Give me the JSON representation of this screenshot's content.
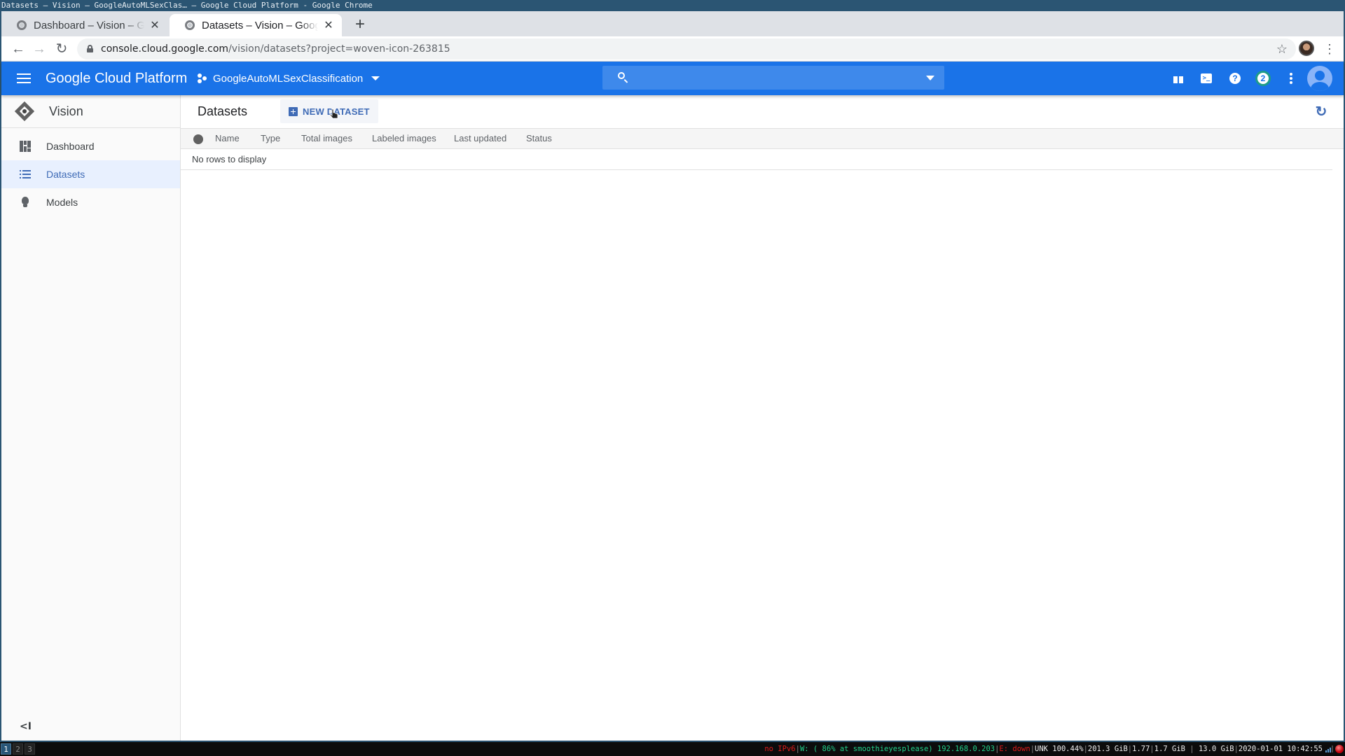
{
  "window": {
    "title": "Datasets – Vision – GoogleAutoMLSexClas… – Google Cloud Platform - Google Chrome"
  },
  "browser": {
    "tabs": [
      {
        "title": "Dashboard – Vision – Google Cloud Platform",
        "active": false
      },
      {
        "title": "Datasets – Vision – Google Cloud Platform",
        "active": true
      }
    ],
    "new_tab_label": "+",
    "url_host": "console.cloud.google.com",
    "url_path": "/vision/datasets?project=woven-icon-263815",
    "icons": {
      "back": "arrow-left-icon",
      "forward": "arrow-right-icon",
      "reload": "reload-icon",
      "lock": "lock-icon",
      "bookmark": "star-icon",
      "profile": "profile-avatar",
      "menu": "kebab-menu-icon"
    }
  },
  "header": {
    "brand": "Google Cloud Platform",
    "project_name": "GoogleAutoMLSexClassification",
    "search_placeholder": "",
    "notification_count": "2",
    "colors": {
      "bar": "#1a73e8",
      "notif_ring": "#1e9c8a"
    }
  },
  "sidebar": {
    "product": "Vision",
    "items": [
      {
        "label": "Dashboard",
        "icon": "dashboard-icon",
        "active": false
      },
      {
        "label": "Datasets",
        "icon": "list-icon",
        "active": true
      },
      {
        "label": "Models",
        "icon": "lightbulb-icon",
        "active": false
      }
    ],
    "collapse_label": "<I",
    "colors": {
      "active_bg": "#e8f0fe",
      "active_text": "#3f6bb6"
    }
  },
  "main": {
    "title": "Datasets",
    "new_dataset_label": "NEW DATASET",
    "columns": [
      "Name",
      "Type",
      "Total images",
      "Labeled images",
      "Last updated",
      "Status"
    ],
    "empty_message": "No rows to display"
  },
  "statusbar": {
    "workspaces": [
      "1",
      "2",
      "3"
    ],
    "current_workspace": "1",
    "ipv6": "no IPv6",
    "wifi": "W: ( 86% at smoothieyesplease) 192.168.0.203",
    "ethernet": "E: down",
    "battery": "UNK 100.44%",
    "disk": "201.3 GiB",
    "load": "1.77",
    "mem_used": "1.7 GiB",
    "mem_total": "13.0 GiB",
    "datetime": "2020-01-01 10:42:55"
  }
}
